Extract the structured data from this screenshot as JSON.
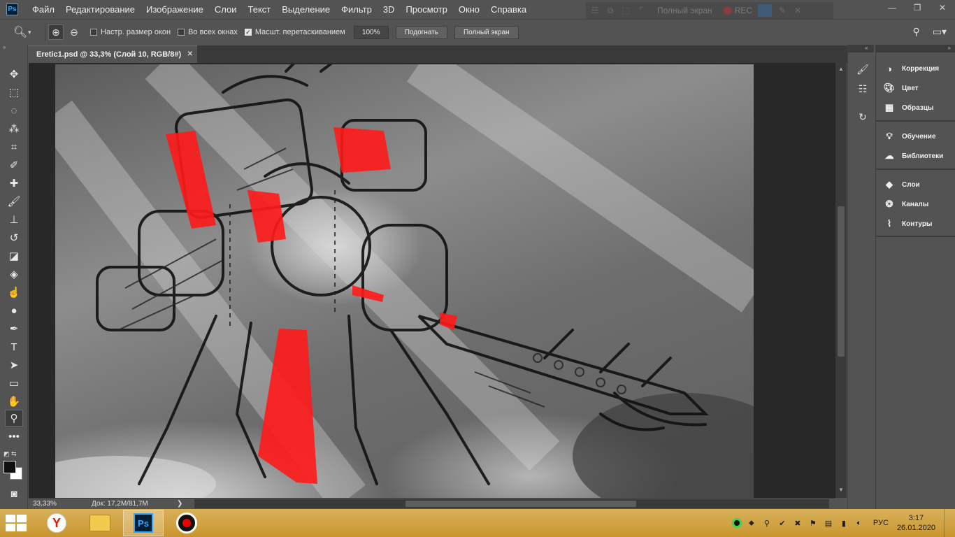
{
  "app": {
    "logo_text": "Ps",
    "menu": [
      "Файл",
      "Редактирование",
      "Изображение",
      "Слои",
      "Текст",
      "Выделение",
      "Фильтр",
      "3D",
      "Просмотр",
      "Окно",
      "Справка"
    ]
  },
  "overlay": {
    "fullscreen_label": "Полный экран",
    "rec_label": "REC"
  },
  "window_controls": {
    "minimize": "—",
    "restore": "❐",
    "close": "✕"
  },
  "options_bar": {
    "resize_windows_label": "Настр. размер окон",
    "resize_windows_checked": false,
    "all_windows_label": "Во всех окнах",
    "all_windows_checked": false,
    "scrubby_zoom_label": "Масшт. перетаскиванием",
    "scrubby_zoom_checked": true,
    "zoom_value": "100%",
    "fit_button": "Подогнать",
    "fullscreen_button": "Полный экран"
  },
  "document": {
    "tab_title": "Eretic1.psd @ 33,3% (Слой 10, RGB/8#)",
    "close_glyph": "✕"
  },
  "status": {
    "zoom": "33,33%",
    "doc_size": "Док: 17,2M/81,7M",
    "arrow": "❯"
  },
  "panels": {
    "items": [
      {
        "label": "Коррекция",
        "icon": "adjustments-icon"
      },
      {
        "label": "Цвет",
        "icon": "color-palette-icon"
      },
      {
        "label": "Образцы",
        "icon": "swatches-grid-icon"
      },
      {
        "label": "Обучение",
        "icon": "lightbulb-icon"
      },
      {
        "label": "Библиотеки",
        "icon": "cc-libraries-icon"
      },
      {
        "label": "Слои",
        "icon": "layers-icon"
      },
      {
        "label": "Каналы",
        "icon": "channels-icon"
      },
      {
        "label": "Контуры",
        "icon": "paths-icon"
      }
    ]
  },
  "taskbar": {
    "yandex_letter": "Y",
    "ps_text": "Ps",
    "language": "РУС",
    "time": "3:17",
    "date": "26.01.2020"
  },
  "colors": {
    "accent_blue": "#31a8ff",
    "rec_red": "#e00000",
    "paint_red": "#ff1a1a"
  }
}
